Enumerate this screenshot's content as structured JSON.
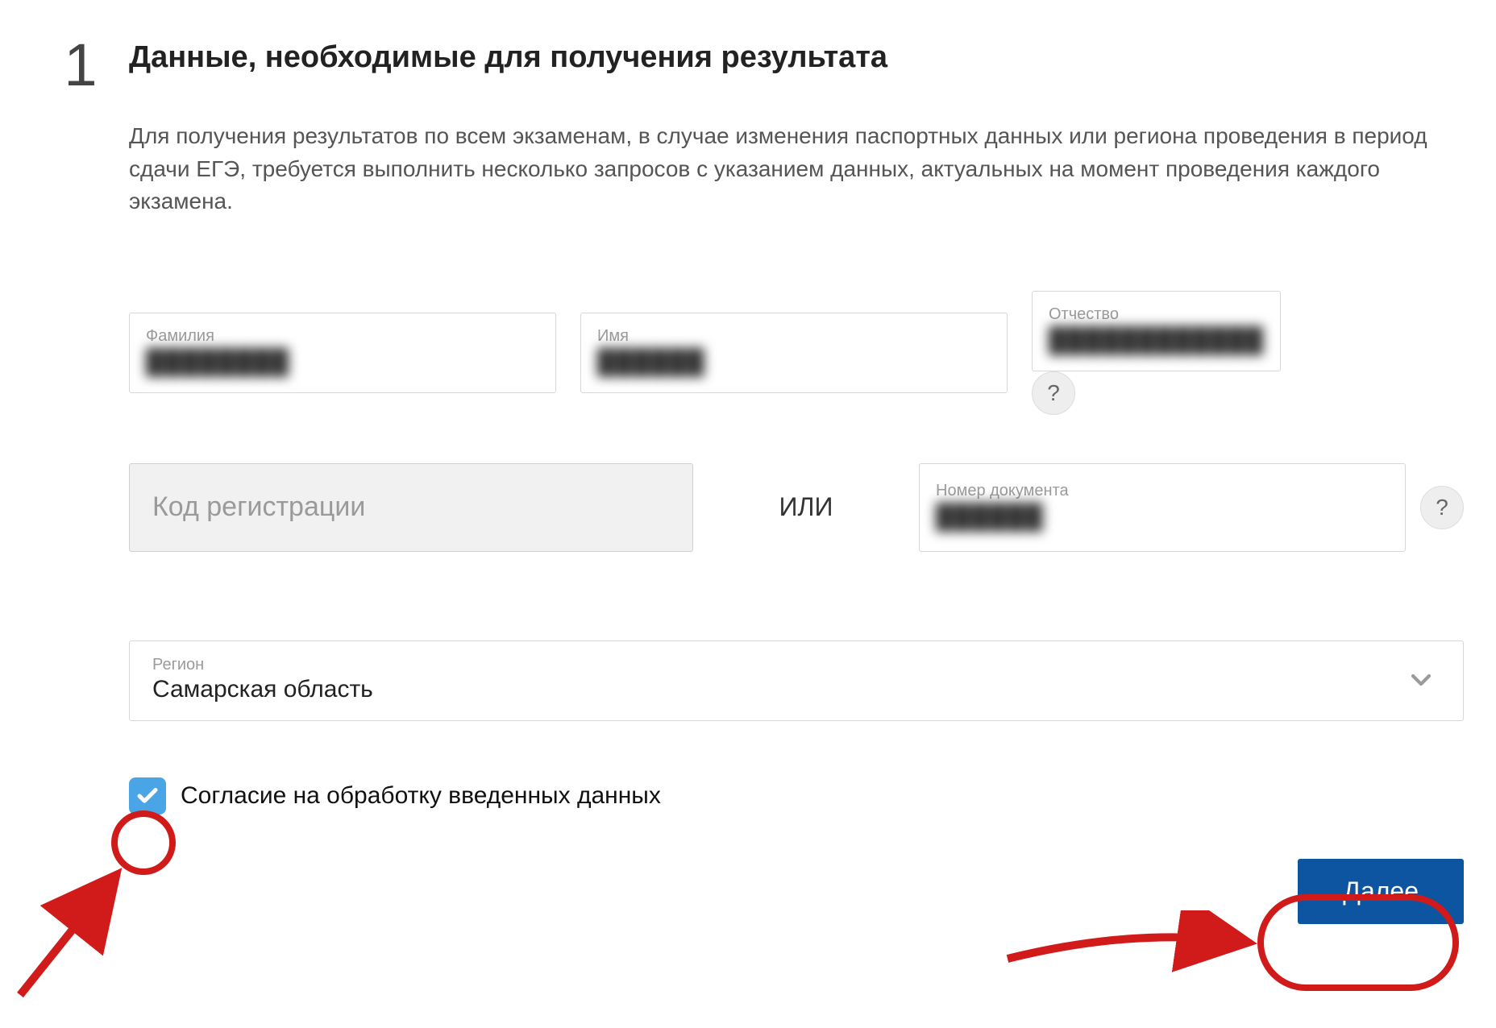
{
  "step_number": "1",
  "heading": "Данные, необходимые для получения результата",
  "description": "Для получения результатов по всем экзаменам, в случае изменения паспортных данных или региона проведения в период сдачи ЕГЭ, требуется выполнить несколько запросов с указанием данных, актуальных на момент проведения каждого экзамена.",
  "fields": {
    "surname": {
      "label": "Фамилия",
      "value": "████████"
    },
    "firstname": {
      "label": "Имя",
      "value": "██████"
    },
    "patronymic": {
      "label": "Отчество",
      "value": "████████████"
    },
    "regcode": {
      "placeholder": "Код регистрации"
    },
    "or_text": "ИЛИ",
    "docno": {
      "label": "Номер документа",
      "value": "██████"
    },
    "region": {
      "label": "Регион",
      "value": "Самарская область"
    }
  },
  "help_icon": "?",
  "consent": {
    "checked": true,
    "label": "Согласие на обработку введенных данных"
  },
  "next_button": "Далее"
}
